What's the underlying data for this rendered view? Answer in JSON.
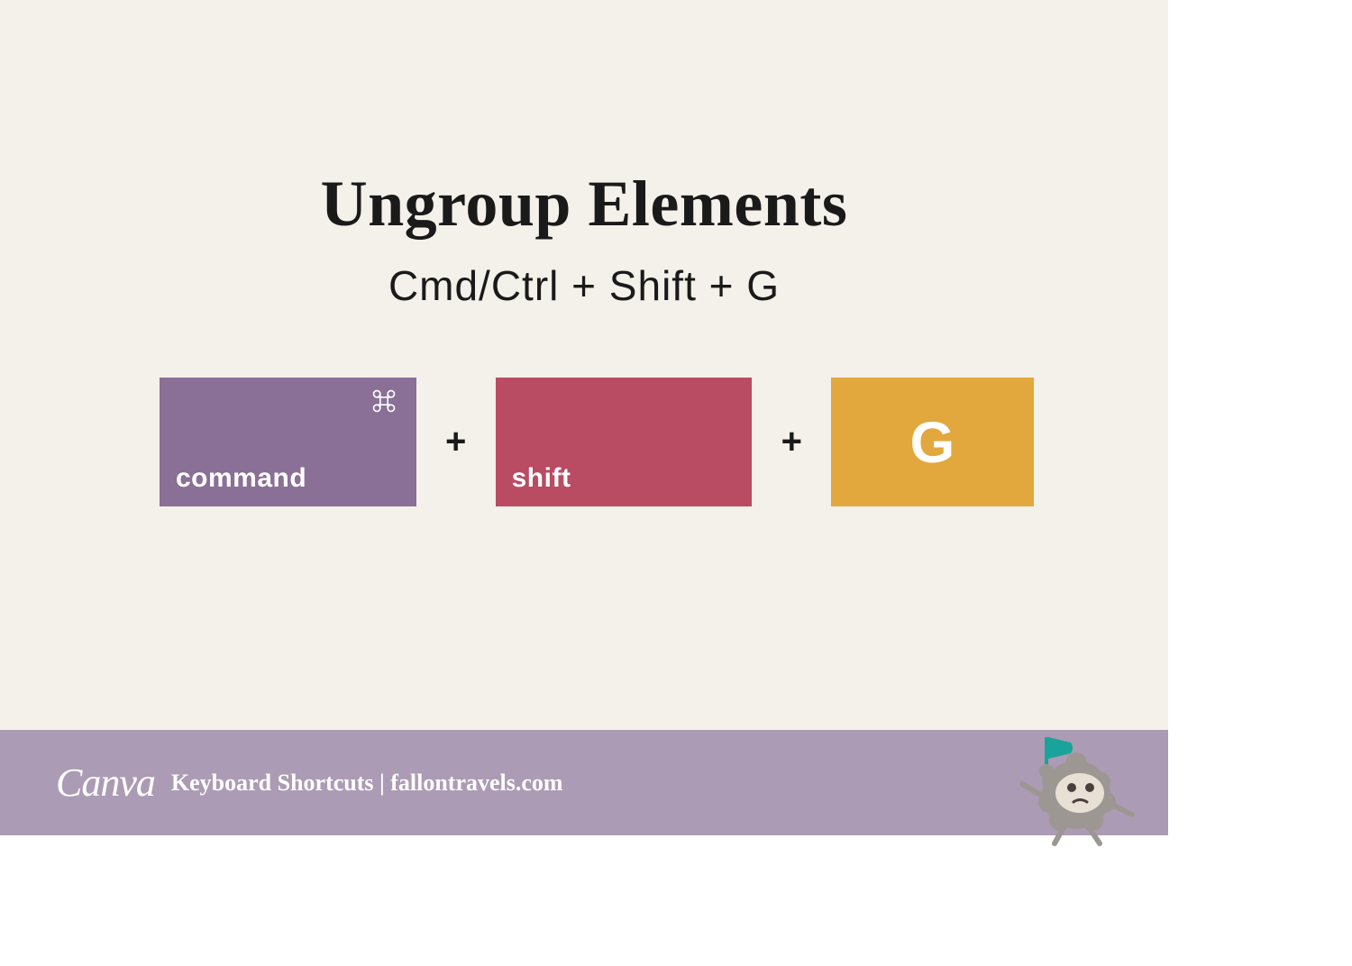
{
  "title": "Ungroup Elements",
  "subtitle": "Cmd/Ctrl + Shift + G",
  "keys": {
    "command_label": "command",
    "shift_label": "shift",
    "g_label": "G",
    "plus": "+"
  },
  "footer": {
    "logo_text": "Canva",
    "text": "Keyboard Shortcuts | fallontravels.com"
  },
  "colors": {
    "bg": "#f4f0ea",
    "command_key": "#8a6f97",
    "shift_key": "#b94b63",
    "g_key": "#e2a83d",
    "footer": "#ac9bb5"
  }
}
